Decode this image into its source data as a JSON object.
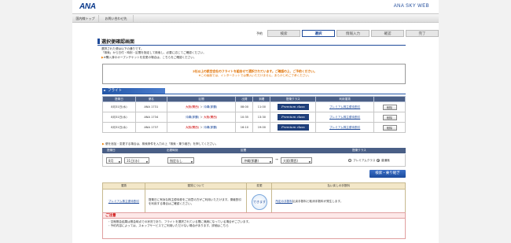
{
  "header": {
    "logo": "ANA",
    "brand": "ANA SKY WEB",
    "nav": [
      "国内線トップ",
      "お問い合わせ先"
    ]
  },
  "steps": {
    "prefix": "予約",
    "items": [
      "検索",
      "選択",
      "情報入力",
      "確認",
      "完了"
    ],
    "current_index": 1
  },
  "page": {
    "title": "選択便確認画面",
    "intro": [
      "選択された便は以下の通りです。",
      "「検索」から日付・時刻・区間を指定して検索し、必要に応じてご確認ください。",
      "※購入済のオープンチケットを変更の場合は、こちらをご確認ください。"
    ],
    "intro_link": "こちら"
  },
  "notice": {
    "line1": "2社以上の航空会社のフライトを組合せて選択されています。ご確認の上、ご予約ください。",
    "line2": "※この画面では、インターネットでは購入いただけません。あらかじめご了承ください。"
  },
  "flights": {
    "section_label": "フライト",
    "headers": [
      "搭乗日",
      "便名",
      "区間",
      "出発",
      "到着",
      "搭乗クラス",
      "利用運賃",
      ""
    ],
    "rows": [
      {
        "date": "8月31日(水)",
        "flight": "ANA 1731",
        "from": "大阪(関西)",
        "to": "沖縄(那覇)",
        "dep": "08:00",
        "arr": "11:00",
        "class": "Premium class",
        "fare": "プレミアム株主優待割引",
        "action": "削除"
      },
      {
        "date": "8月31日(水)",
        "flight": "ANA 1734",
        "from": "沖縄(那覇)",
        "to": "大阪(関西)",
        "dep": "10:35",
        "arr": "13:30",
        "class": "Premium class",
        "fare": "プレミアム株主優待割引",
        "action": "削除"
      },
      {
        "date": "8月31日(水)",
        "flight": "ANA 1737",
        "from": "大阪(関西)",
        "to": "沖縄(那覇)",
        "dep": "16:10",
        "arr": "19:00",
        "class": "Premium class",
        "fare": "プレミアム株主優待割引",
        "action": "削除"
      }
    ]
  },
  "search": {
    "note": "便を追加・変更する場合は、検索条件を入力の上「検索・乗り継ぎ」を押してください。",
    "headers": [
      "搭乗日",
      "出発時刻",
      "区間",
      "搭乗クラス"
    ],
    "month": "8月",
    "day": "31日(水)",
    "time": "指定なし",
    "from": "沖縄(那覇)",
    "to": "大阪(関西)",
    "separator": "→",
    "class_options": [
      "プレミアムクラス",
      "普通席"
    ],
    "class_selected": 1,
    "button": "検索・乗り継ぎ"
  },
  "fare_table": {
    "headers": [
      "運賃",
      "運賃について",
      "変更",
      "払い戻しの手数料"
    ],
    "row": {
      "fare": "プレミアム株主優待割引",
      "about": "搭乗日に有効な株主優待券をご用意の方がご利用いただけます。乗継割引を利用する場合はご確認ください。",
      "change": "できます",
      "refund_link": "所定の手数料",
      "refund": "払戻手数料と取消手数料が発生します。"
    }
  },
  "caution": {
    "title": "ご注意",
    "lines": [
      "・空席照会結果は照会時点での状況であり、フライトを選択されている間に満席になっている場合がございます。",
      "・予約内容によっては、スキップサービスでご利用いただけない場合があります。詳細はこちら"
    ]
  },
  "colors": {
    "brand_blue": "#1e4a9a",
    "table_header": "#4a5f86",
    "notice_orange": "#e07000",
    "caution_red": "#c00000"
  }
}
